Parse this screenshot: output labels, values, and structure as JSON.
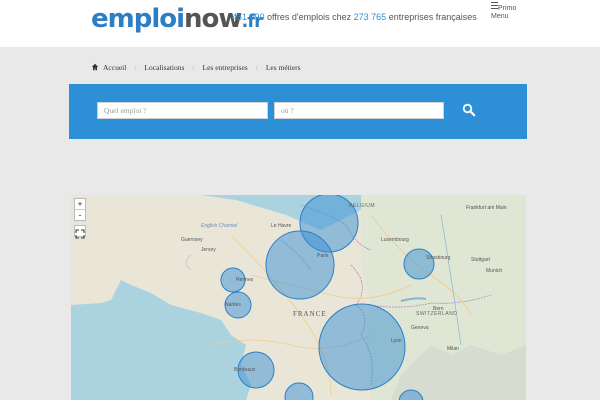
{
  "header": {
    "logo_part1": "emploi",
    "logo_part2": "now",
    "logo_part3": ".fr",
    "stats": {
      "jobs_count": "451 090",
      "jobs_text": " offres d'emplois chez ",
      "companies_count": "273 765",
      "companies_text": " entreprises françaises"
    },
    "menu_label_top": "Primo",
    "menu_label_bottom": "Menu"
  },
  "breadcrumb": {
    "items": [
      {
        "label": "Accueil"
      },
      {
        "label": "Localisations"
      },
      {
        "label": "Les entreprises"
      },
      {
        "label": "Les métiers"
      }
    ]
  },
  "search": {
    "job_placeholder": "Quel emploi ?",
    "where_placeholder": "où ?"
  },
  "map": {
    "zoom_in": "+",
    "zoom_out": "-",
    "labels": {
      "belgium": "BELGIUM",
      "france": "FRANCE",
      "switzerland": "SWITZERLAND",
      "english_channel": "English Channel",
      "paris": "Paris",
      "luxembourg": "Luxembourg",
      "frankfurt": "Frankfurt am Main",
      "stuttgart": "Stuttgart",
      "munich": "Munich",
      "milan": "Milan",
      "nantes": "Nantes",
      "bordeaux": "Bordeaux",
      "lyon": "Lyon",
      "geneva": "Geneva",
      "bern": "Bern",
      "strasbourg": "Strasbourg",
      "nice": "Nice",
      "guernsey": "Guernsey",
      "jersey": "Jersey",
      "rennes": "Rennes",
      "le_havre": "Le Havre",
      "rouen": "Rouen"
    }
  },
  "colors": {
    "brand_blue": "#2c7fc4",
    "search_bar": "#2d8fd5",
    "bubble_fill": "#3a8fd6"
  }
}
